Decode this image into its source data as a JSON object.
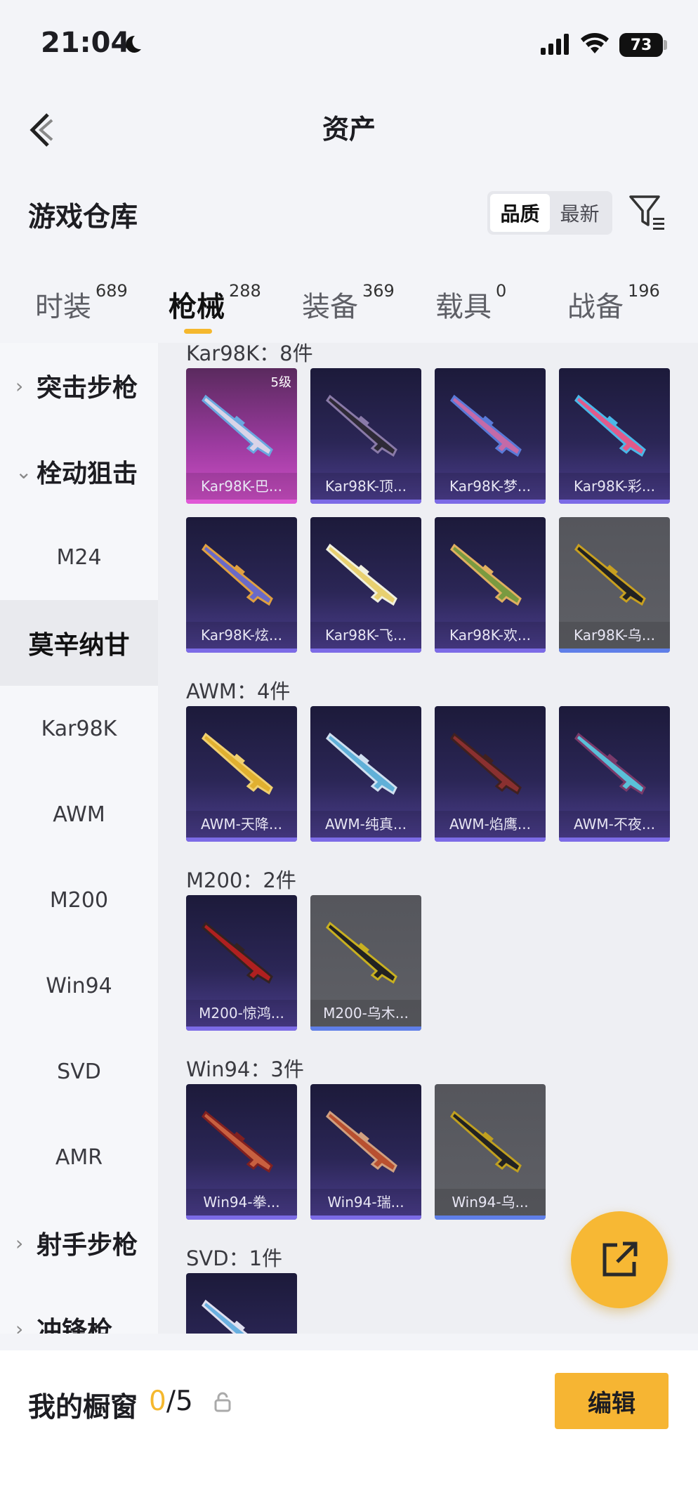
{
  "status_bar": {
    "time": "21:04",
    "battery": "73"
  },
  "header": {
    "title": "资产"
  },
  "warehouse": {
    "title": "游戏仓库",
    "sort_options": [
      "品质",
      "最新"
    ],
    "sort_selected": "品质"
  },
  "tabs": [
    {
      "label": "时装",
      "count": "689"
    },
    {
      "label": "枪械",
      "count": "288",
      "active": true
    },
    {
      "label": "装备",
      "count": "369"
    },
    {
      "label": "载具",
      "count": "0"
    },
    {
      "label": "战备",
      "count": "196"
    }
  ],
  "sidebar": {
    "items": [
      {
        "label": "突击步枪",
        "type": "category",
        "chevron": "›"
      },
      {
        "label": "栓动狙击",
        "type": "category",
        "chevron": "⌄"
      },
      {
        "label": "M24",
        "type": "item"
      },
      {
        "label": "莫辛纳甘",
        "type": "item",
        "selected": true
      },
      {
        "label": "Kar98K",
        "type": "item"
      },
      {
        "label": "AWM",
        "type": "item"
      },
      {
        "label": "M200",
        "type": "item"
      },
      {
        "label": "Win94",
        "type": "item"
      },
      {
        "label": "SVD",
        "type": "item"
      },
      {
        "label": "AMR",
        "type": "item"
      },
      {
        "label": "射手步枪",
        "type": "category",
        "chevron": "›"
      },
      {
        "label": "冲锋枪",
        "type": "category",
        "chevron": "›"
      }
    ]
  },
  "groups": [
    {
      "title": "Kar98K：8件",
      "items": [
        {
          "name": "Kar98K-巴...",
          "rarity": "legend",
          "level": "5级"
        },
        {
          "name": "Kar98K-顶...",
          "rarity": "epic"
        },
        {
          "name": "Kar98K-梦...",
          "rarity": "epic"
        },
        {
          "name": "Kar98K-彩...",
          "rarity": "epic"
        },
        {
          "name": "Kar98K-炫...",
          "rarity": "epic"
        },
        {
          "name": "Kar98K-飞...",
          "rarity": "epic"
        },
        {
          "name": "Kar98K-欢...",
          "rarity": "epic"
        },
        {
          "name": "Kar98K-乌...",
          "rarity": "common"
        }
      ]
    },
    {
      "title": "AWM：4件",
      "items": [
        {
          "name": "AWM-天降...",
          "rarity": "epic"
        },
        {
          "name": "AWM-纯真...",
          "rarity": "epic"
        },
        {
          "name": "AWM-焰鹰...",
          "rarity": "epic"
        },
        {
          "name": "AWM-不夜...",
          "rarity": "epic"
        }
      ]
    },
    {
      "title": "M200：2件",
      "items": [
        {
          "name": "M200-惊鸿...",
          "rarity": "epic"
        },
        {
          "name": "M200-乌木...",
          "rarity": "common"
        }
      ]
    },
    {
      "title": "Win94：3件",
      "items": [
        {
          "name": "Win94-拳...",
          "rarity": "epic"
        },
        {
          "name": "Win94-瑞...",
          "rarity": "epic"
        },
        {
          "name": "Win94-乌...",
          "rarity": "common"
        }
      ]
    },
    {
      "title": "SVD：1件",
      "items": [
        {
          "name": "",
          "rarity": "epic"
        }
      ]
    }
  ],
  "showcase": {
    "label": "我的橱窗",
    "current": "0",
    "max": "/5",
    "edit_label": "编辑"
  },
  "colors": {
    "accent": "#f5b82e",
    "epic": "#7c6be6",
    "legend": "#e058d6",
    "common": "#5f7fe8"
  }
}
